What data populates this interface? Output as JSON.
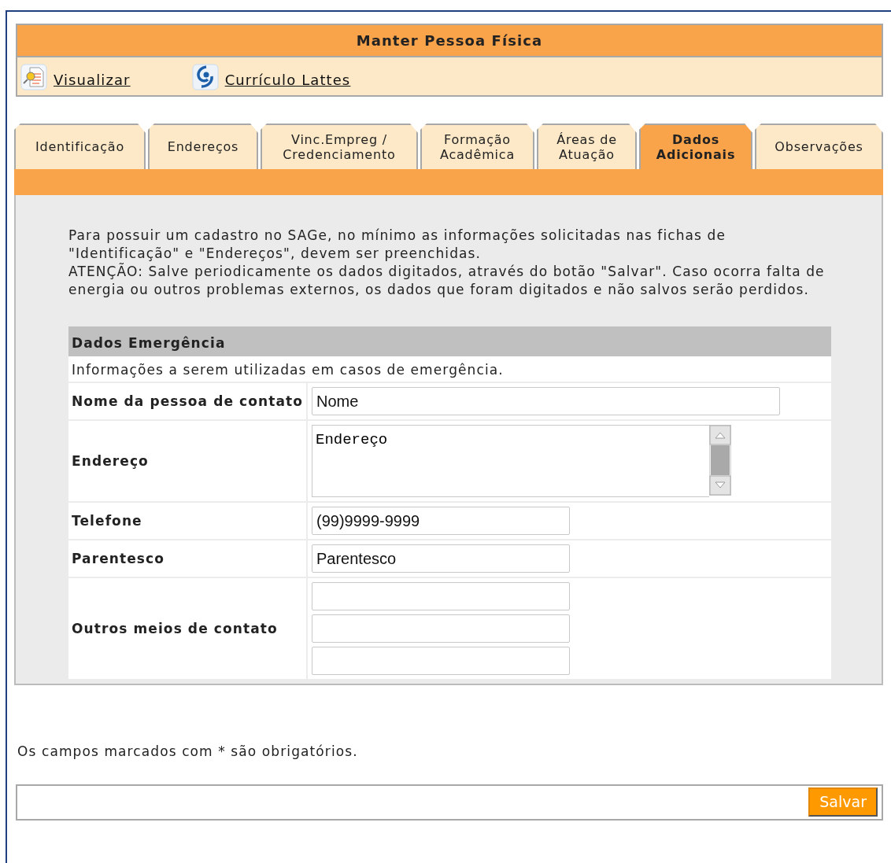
{
  "header": {
    "title": "Manter Pessoa Física",
    "links": [
      {
        "label": "Visualizar",
        "kind": "view"
      },
      {
        "label": "Currículo Lattes",
        "kind": "lattes"
      }
    ]
  },
  "tabs": [
    {
      "label": "Identificação",
      "selected": false
    },
    {
      "label": "Endereços",
      "selected": false
    },
    {
      "label": "Vinc.Empreg / Credenciamento",
      "selected": false
    },
    {
      "label": "Formação Acadêmica",
      "selected": false
    },
    {
      "label": "Áreas de Atuação",
      "selected": false
    },
    {
      "label": "Dados Adicionais",
      "selected": true
    },
    {
      "label": "Observações",
      "selected": false
    }
  ],
  "intro": [
    "Para possuir um cadastro no SAGe, no mínimo as informações solicitadas nas fichas de \"Identificação\" e \"Endereços\", devem ser preenchidas.",
    "ATENÇÃO: Salve periodicamente os dados digitados, através do botão \"Salvar\". Caso ocorra falta de energia ou outros problemas externos, os dados que foram digitados e não salvos serão perdidos."
  ],
  "section": {
    "title": "Dados Emergência",
    "description": "Informações a serem utilizadas em casos de emergência.",
    "rows": [
      {
        "label": "Nome da pessoa de contato",
        "fields": [
          {
            "kind": "wide",
            "value": "Nome"
          }
        ]
      },
      {
        "label": "Endereço",
        "fields": [
          {
            "kind": "textarea",
            "value": "Endereço"
          }
        ]
      },
      {
        "label": "Telefone",
        "fields": [
          {
            "kind": "short",
            "value": "(99)9999-9999"
          }
        ]
      },
      {
        "label": "Parentesco",
        "fields": [
          {
            "kind": "short",
            "value": "Parentesco"
          }
        ]
      },
      {
        "label": "Outros meios de contato",
        "fields": [
          {
            "kind": "short"
          },
          {
            "kind": "short"
          },
          {
            "kind": "short"
          }
        ]
      }
    ]
  },
  "footnote": "Os campos marcados com * são obrigatórios.",
  "save_button": "Salvar"
}
